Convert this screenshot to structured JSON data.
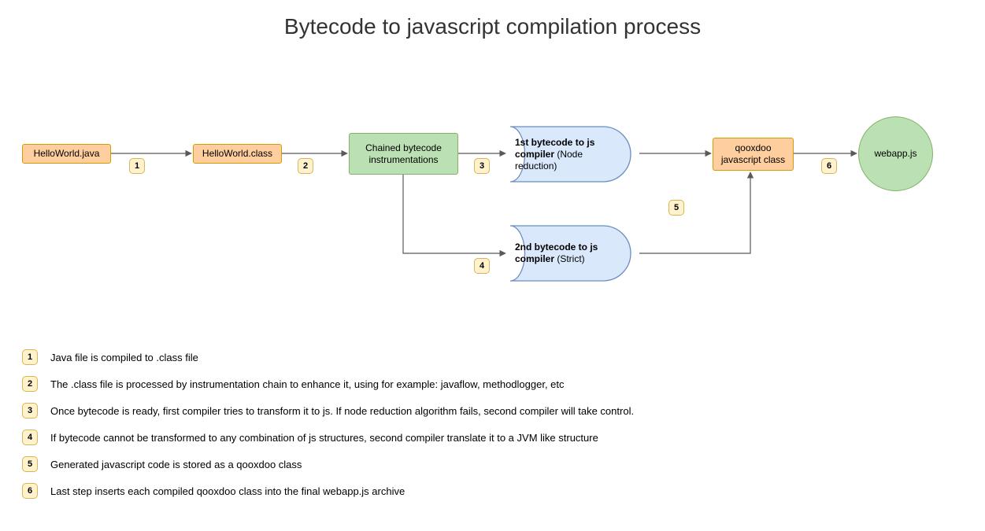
{
  "title": "Bytecode to javascript compilation process",
  "nodes": {
    "java": "HelloWorld.java",
    "class": "HelloWorld.class",
    "instr": "Chained bytecode instrumentations",
    "comp1_b": "1st bytecode to js compiler",
    "comp1_p": " (Node reduction)",
    "comp2_b": "2nd bytecode to js compiler",
    "comp2_p": " (Strict)",
    "qx": "qooxdoo javascript class",
    "out": "webapp.js"
  },
  "steps": {
    "s1": "1",
    "s2": "2",
    "s3": "3",
    "s4": "4",
    "s5": "5",
    "s6": "6"
  },
  "legend": {
    "l1": "Java file is compiled to .class file",
    "l2": "The .class file is processed by instrumentation chain to enhance it, using for example: javaflow, methodlogger, etc",
    "l3": "Once bytecode is ready, first compiler tries to transform it to js. If node reduction algorithm fails, second compiler will take control.",
    "l4": "If bytecode cannot be transformed to any combination of js structures, second compiler translate it to a JVM like structure",
    "l5": "Generated javascript code is stored as a qooxdoo class",
    "l6": "Last step inserts each compiled qooxdoo class into the final webapp.js archive"
  }
}
